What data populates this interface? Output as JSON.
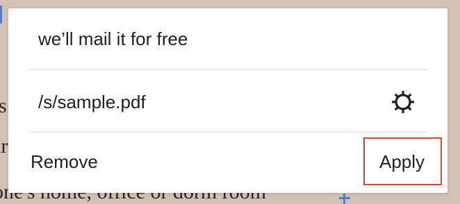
{
  "background_document": {
    "fragments": [
      "s",
      "rs",
      "ar",
      "one's home, office or dorm room"
    ]
  },
  "link_popup": {
    "link_text": "we’ll mail it for free",
    "link_url": "/s/sample.pdf",
    "settings_icon": "gear-icon",
    "remove_label": "Remove",
    "apply_label": "Apply"
  },
  "colors": {
    "highlight_border": "#d24a35",
    "selection_handle": "#4a7fd8",
    "page_background": "#d3c1b3"
  }
}
